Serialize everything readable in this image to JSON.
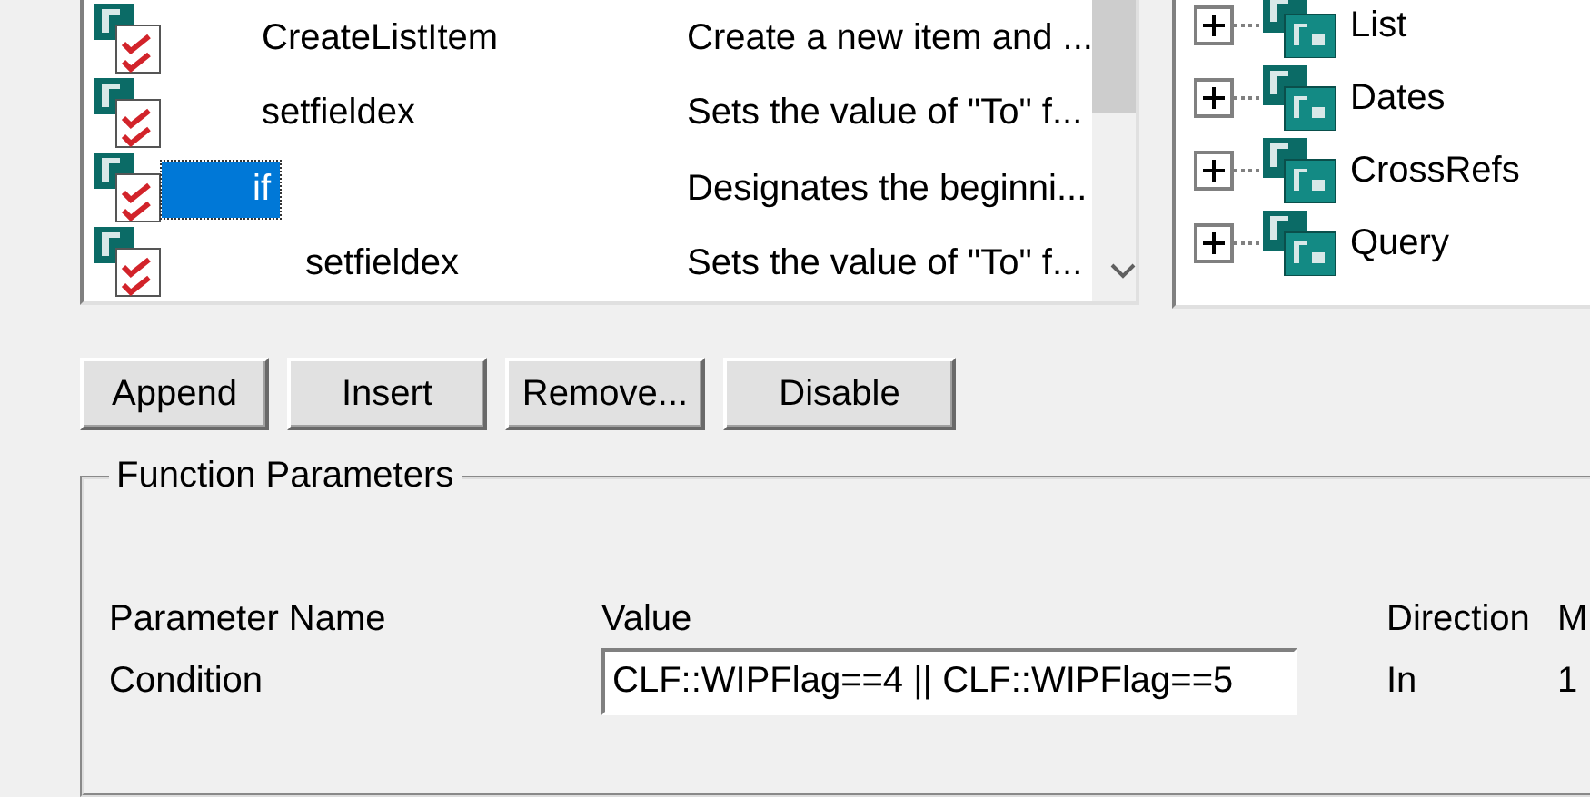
{
  "function_list": {
    "rows": [
      {
        "name": "CreateListItem",
        "description": "Create a new item and ...",
        "selected": false
      },
      {
        "name": "setfieldex",
        "description": "Sets the value of \"To\" f...",
        "selected": false
      },
      {
        "name": "if",
        "description": "Designates the beginni...",
        "selected": true,
        "children": [
          {
            "name": "setfieldex",
            "description": "Sets the value of \"To\" f...",
            "selected": false
          }
        ]
      }
    ]
  },
  "function_tree": {
    "items": [
      {
        "label": "List",
        "expanded": false
      },
      {
        "label": "Dates",
        "expanded": false
      },
      {
        "label": "CrossRefs",
        "expanded": false
      },
      {
        "label": "Query",
        "expanded": false
      }
    ]
  },
  "buttons": [
    "Append",
    "Insert",
    "Remove...",
    "Disable"
  ],
  "function_parameters": {
    "title": "Function Parameters",
    "columns": [
      "Parameter Name",
      "Value",
      "Direction",
      "M"
    ],
    "rows": [
      {
        "name": "Condition",
        "value": "CLF::WIPFlag==4 || CLF::WIPFlag==5",
        "direction": "In",
        "column_4": "1"
      }
    ]
  }
}
